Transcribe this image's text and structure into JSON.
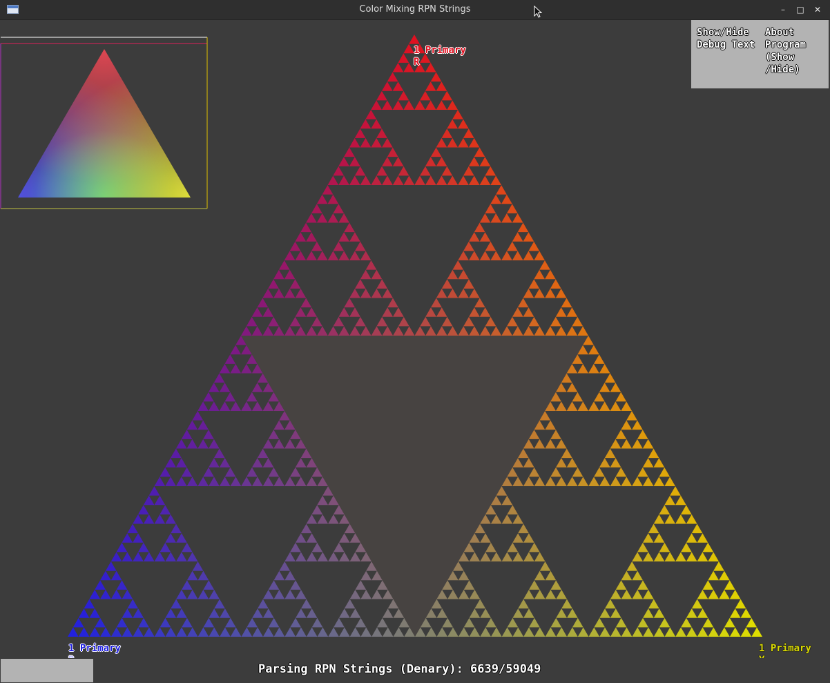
{
  "window": {
    "title": "Color Mixing RPN Strings",
    "minimize_glyph": "–",
    "maximize_glyph": "□",
    "close_glyph": "✕"
  },
  "colors": {
    "red": "#e01020",
    "blue": "#2020e0",
    "yellow": "#e0e000",
    "green": "#20c020",
    "background": "#3c3c3c"
  },
  "vertices": {
    "top": {
      "count_label": "1 Primary",
      "letter": "R"
    },
    "bottom_left": {
      "count_label": "1 Primary",
      "letter": "B"
    },
    "bottom_right": {
      "count_label": "1 Primary",
      "letter": "Y"
    }
  },
  "menu": {
    "debug_button": "Show/Hide\nDebug Text",
    "about_button": "About\nProgram\n(Show\n/Hide)"
  },
  "status": {
    "text": "Parsing RPN Strings (Denary): 6639/59049",
    "processed": 6639,
    "total": 59049,
    "progress_fraction": 0.1124
  },
  "icons": {
    "app": "window-icon",
    "minimize": "minimize-icon",
    "maximize": "maximize-icon",
    "close": "close-icon",
    "cursor": "mouse-cursor-icon"
  }
}
